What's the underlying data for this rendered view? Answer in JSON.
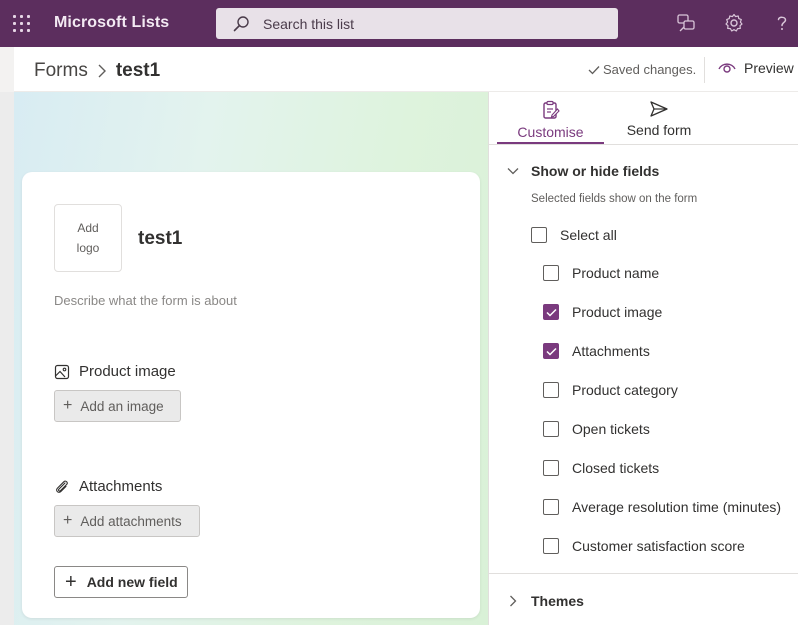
{
  "app": {
    "name": "Microsoft Lists"
  },
  "search": {
    "placeholder": "Search this list"
  },
  "breadcrumb": {
    "parent": "Forms",
    "current": "test1"
  },
  "header": {
    "saved_status": "Saved changes.",
    "preview_label": "Preview"
  },
  "form": {
    "logo_line1": "Add",
    "logo_line2": "logo",
    "title": "test1",
    "description_placeholder": "Describe what the form is about",
    "fields": [
      {
        "label": "Product image",
        "button": "Add an image",
        "icon": "image-icon"
      },
      {
        "label": "Attachments",
        "button": "Add attachments",
        "icon": "paperclip-icon"
      }
    ],
    "add_field_label": "Add new field"
  },
  "panel": {
    "tabs": [
      {
        "label": "Customise",
        "icon": "edit-form-icon",
        "active": true
      },
      {
        "label": "Send form",
        "icon": "send-icon",
        "active": false
      }
    ],
    "show_hide": {
      "title": "Show or hide fields",
      "subtitle": "Selected fields show on the form",
      "select_all": {
        "label": "Select all",
        "checked": false
      },
      "items": [
        {
          "label": "Product name",
          "checked": false
        },
        {
          "label": "Product image",
          "checked": true
        },
        {
          "label": "Attachments",
          "checked": true
        },
        {
          "label": "Product category",
          "checked": false
        },
        {
          "label": "Open tickets",
          "checked": false
        },
        {
          "label": "Closed tickets",
          "checked": false
        },
        {
          "label": "Average resolution time (minutes)",
          "checked": false
        },
        {
          "label": "Customer satisfaction score",
          "checked": false
        }
      ]
    },
    "themes": {
      "title": "Themes"
    }
  },
  "colors": {
    "suite_bar": "#5c2e5e",
    "accent": "#7a3a7e"
  }
}
